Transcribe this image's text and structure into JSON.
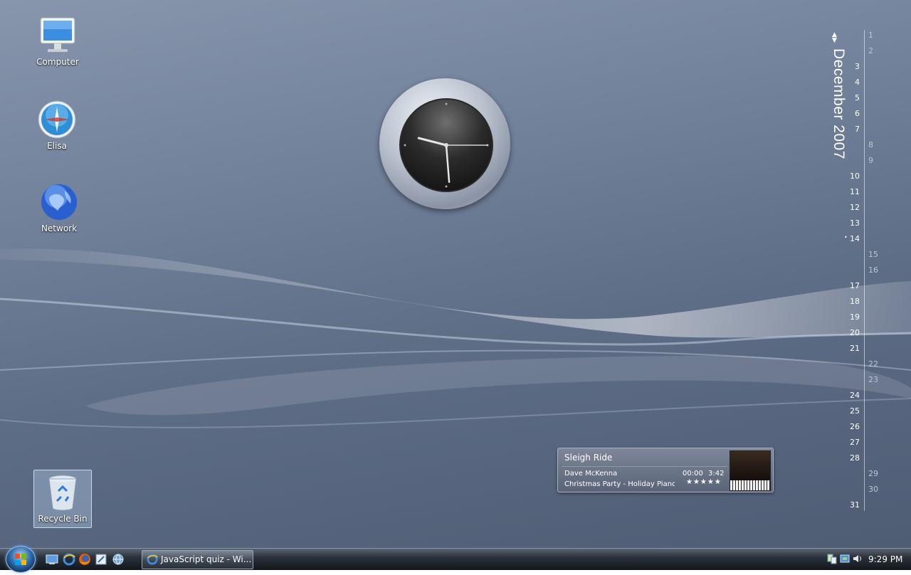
{
  "desktop_icons": {
    "computer": "Computer",
    "elisa": "Elisa",
    "network": "Network",
    "recycle_bin": "Recycle Bin"
  },
  "calendar": {
    "month_title": "December 2007",
    "today": 14,
    "days": [
      "1",
      "2",
      "3",
      "4",
      "5",
      "6",
      "7",
      "8",
      "9",
      "10",
      "11",
      "12",
      "13",
      "14",
      "15",
      "16",
      "17",
      "18",
      "19",
      "20",
      "21",
      "22",
      "23",
      "24",
      "25",
      "26",
      "27",
      "28",
      "29",
      "30",
      "31"
    ]
  },
  "clock": {
    "hour": 9,
    "minute": 29,
    "second": 15
  },
  "media_player": {
    "track_title": "Sleigh Ride",
    "artist": "Dave McKenna",
    "album": "Christmas Party - Holiday Piano S",
    "elapsed": "00:00",
    "duration": "3:42",
    "rating_stars": "★★★★★"
  },
  "taskbar": {
    "task_label": "JavaScript quiz - Wi...",
    "clock_text": "9:29 PM"
  },
  "icons": {
    "start": "windows-orb-icon",
    "quick_launch": [
      "show-desktop-icon",
      "internet-explorer-icon",
      "firefox-icon",
      "switch-windows-icon",
      "globe-icon"
    ],
    "tray": [
      "network-icon",
      "safely-remove-icon",
      "volume-icon"
    ]
  },
  "colors": {
    "desktop_top": "#8796ad",
    "desktop_bottom": "#4e5c74",
    "taskbar": "#12161c"
  }
}
